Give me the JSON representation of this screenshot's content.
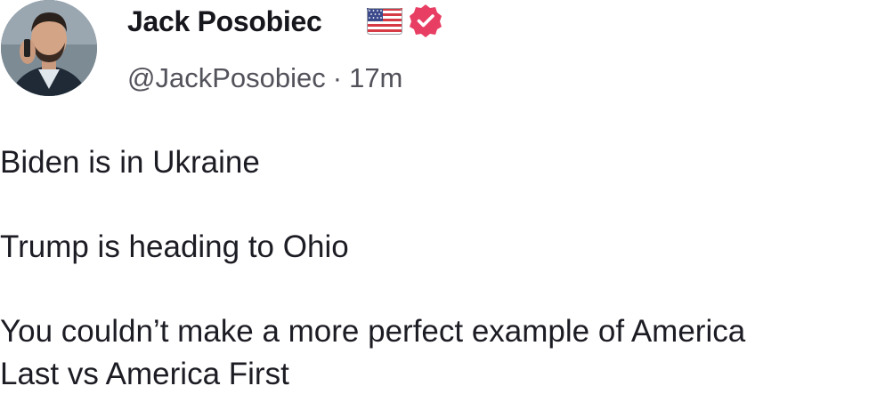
{
  "post": {
    "author": {
      "display_name": "Jack Posobiec",
      "handle": "@JackPosobiec",
      "flag_icon": "us-flag-icon",
      "verified_icon": "verified-badge-icon",
      "verified_color": "#e83e63"
    },
    "separator": "·",
    "timestamp": "17m",
    "body": {
      "line1": "Biden is in Ukraine",
      "line2": "Trump is heading to Ohio",
      "line3": "You couldn’t make a more perfect example of America",
      "line4": "Last vs America First"
    }
  }
}
